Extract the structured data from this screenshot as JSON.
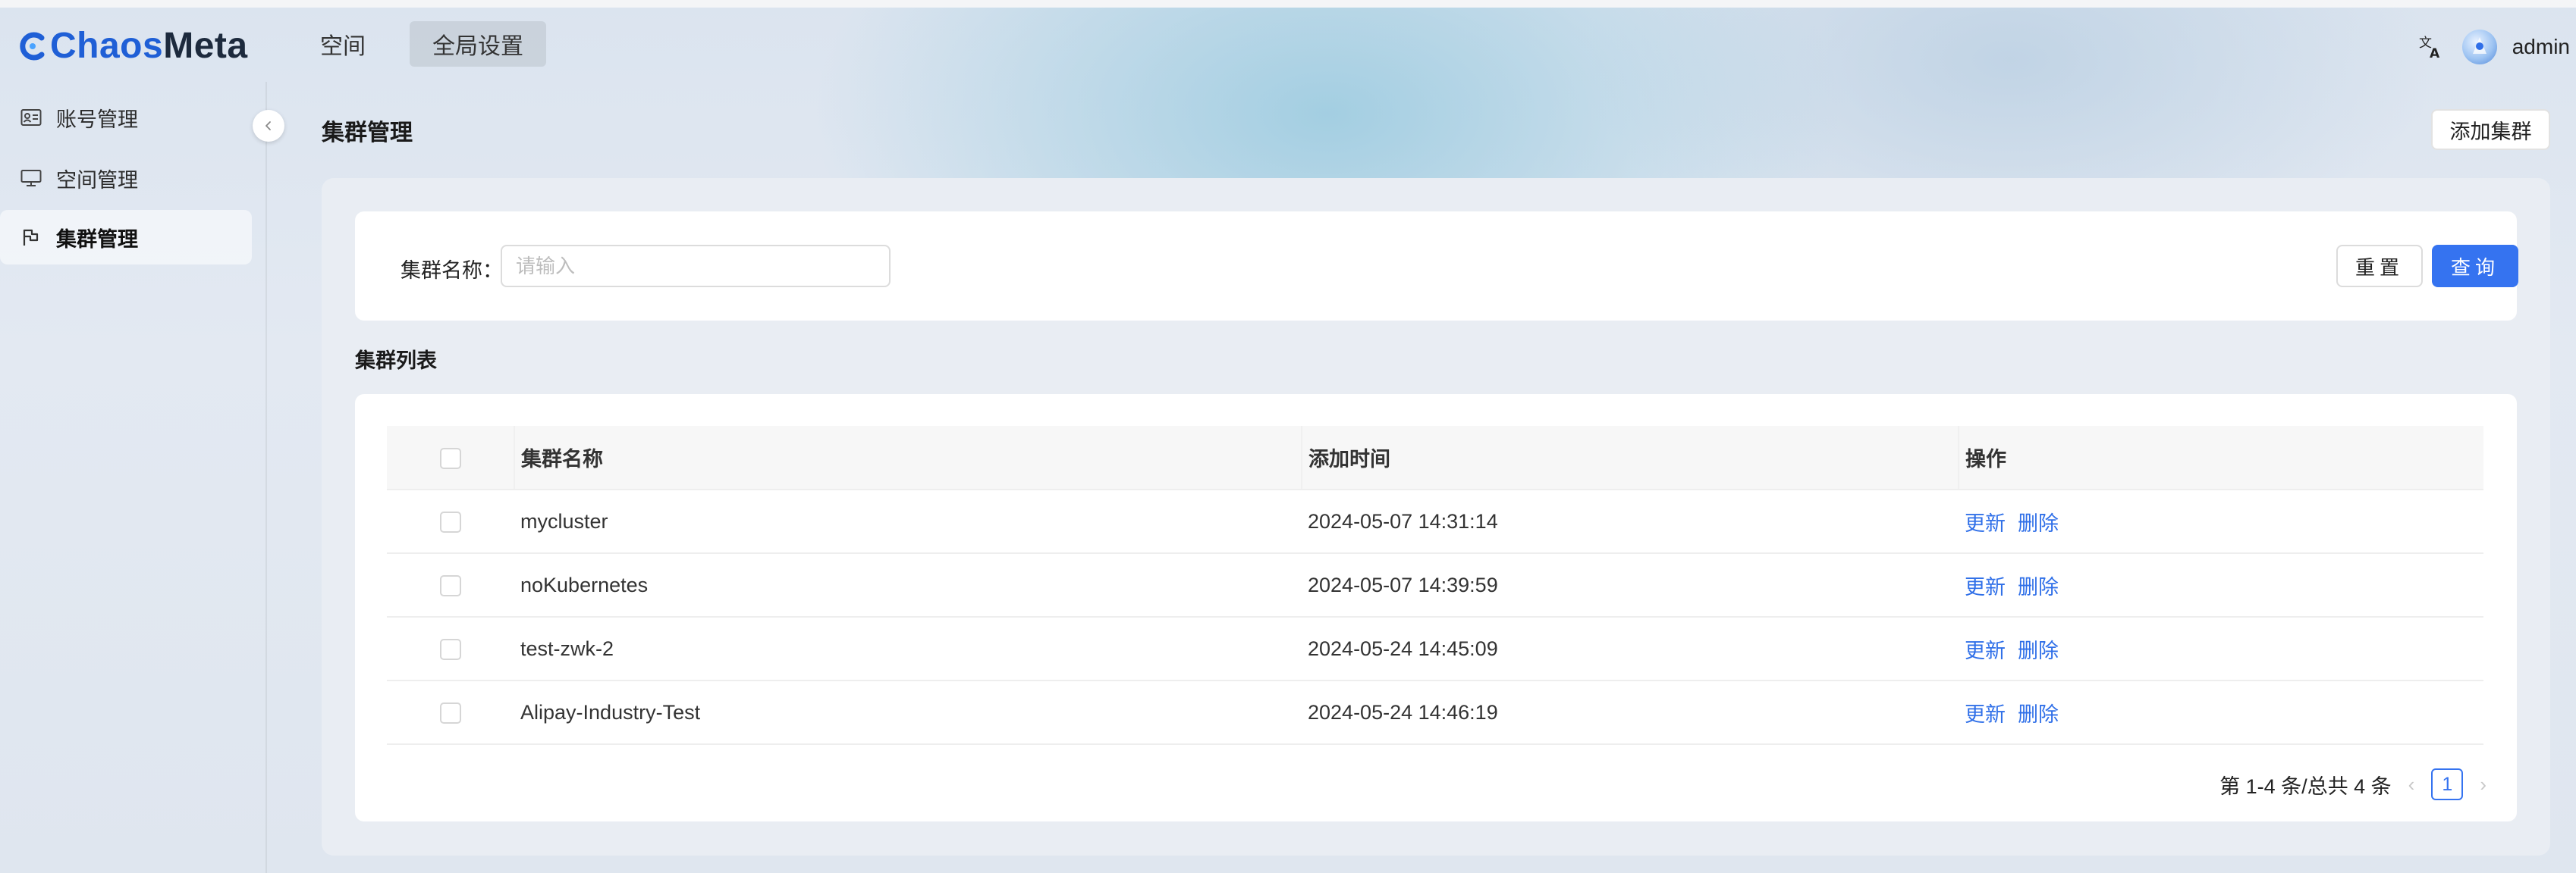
{
  "app": {
    "logo_part1": "Chaos",
    "logo_part2": "Meta",
    "brand_color": "#1f5fd6"
  },
  "topnav": [
    {
      "label": "空间",
      "active": false
    },
    {
      "label": "全局设置",
      "active": true
    }
  ],
  "header": {
    "username": "admin",
    "translate_icon": "translate-icon",
    "avatar_icon": "avatar"
  },
  "sidebar": {
    "items": [
      {
        "label": "账号管理",
        "icon": "id-card-icon"
      },
      {
        "label": "空间管理",
        "icon": "monitor-icon"
      },
      {
        "label": "集群管理",
        "icon": "flag-icon",
        "active": true
      }
    ]
  },
  "page": {
    "title": "集群管理",
    "add_button": "添加集群"
  },
  "search": {
    "label": "集群名称：",
    "placeholder": "请输入",
    "value": "",
    "reset_label": "重置",
    "query_label": "查询",
    "accent": "#3573f0"
  },
  "list": {
    "title": "集群列表",
    "columns": [
      "集群名称",
      "添加时间",
      "操作"
    ],
    "rows": [
      {
        "name": "mycluster",
        "time": "2024-05-07 14:31:14",
        "update": "更新",
        "delete": "删除"
      },
      {
        "name": "noKubernetes",
        "time": "2024-05-07 14:39:59",
        "update": "更新",
        "delete": "删除"
      },
      {
        "name": "test-zwk-2",
        "time": "2024-05-24 14:45:09",
        "update": "更新",
        "delete": "删除"
      },
      {
        "name": "Alipay-Industry-Test",
        "time": "2024-05-24 14:46:19",
        "update": "更新",
        "delete": "删除"
      }
    ]
  },
  "pagination": {
    "summary": "第 1-4 条/总共 4 条",
    "current_page": "1"
  }
}
